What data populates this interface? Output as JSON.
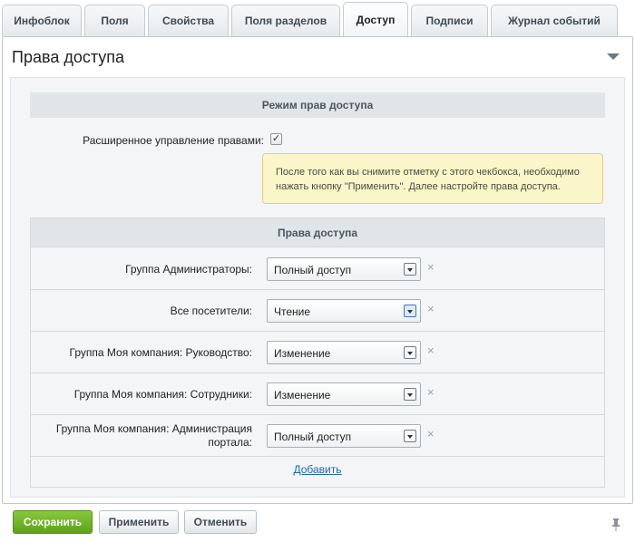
{
  "tabs": [
    {
      "label": "Инфоблок"
    },
    {
      "label": "Поля"
    },
    {
      "label": "Свойства"
    },
    {
      "label": "Поля разделов"
    },
    {
      "label": "Доступ"
    },
    {
      "label": "Подписи"
    },
    {
      "label": "Журнал событий"
    }
  ],
  "active_tab": "Доступ",
  "panel": {
    "title": "Права доступа"
  },
  "mode_section": {
    "heading": "Режим прав доступа",
    "extended_label": "Расширенное управление правами:",
    "extended_checked": true,
    "notice": "После того как вы снимите отметку с этого чекбокса, необходимо нажать кнопку \"Применить\". Далее настройте права доступа."
  },
  "rights_section": {
    "heading": "Права доступа",
    "rows": [
      {
        "group": "Группа Администраторы:",
        "access": "Полный доступ"
      },
      {
        "group": "Все посетители:",
        "access": "Чтение"
      },
      {
        "group": "Группа Моя компания: Руководство:",
        "access": "Изменение"
      },
      {
        "group": "Группа Моя компания: Сотрудники:",
        "access": "Изменение"
      },
      {
        "group_line1": "Группа Моя компания: Администрация",
        "group_line2": "портала:",
        "access": "Полный доступ"
      }
    ],
    "remove_symbol": "×",
    "add_label": "Добавить"
  },
  "footer": {
    "save_label": "Сохранить",
    "apply_label": "Применить",
    "cancel_label": "Отменить"
  },
  "colors": {
    "primary_button": "#6db22a",
    "notice_bg": "#fbf6c9",
    "section_head_bg": "#e0e5e8",
    "link": "#2067b0"
  },
  "icons": {
    "collapse": "chevron-down-icon",
    "pin": "pin-icon",
    "remove": "close-icon",
    "checkbox": "checkmark-icon"
  }
}
